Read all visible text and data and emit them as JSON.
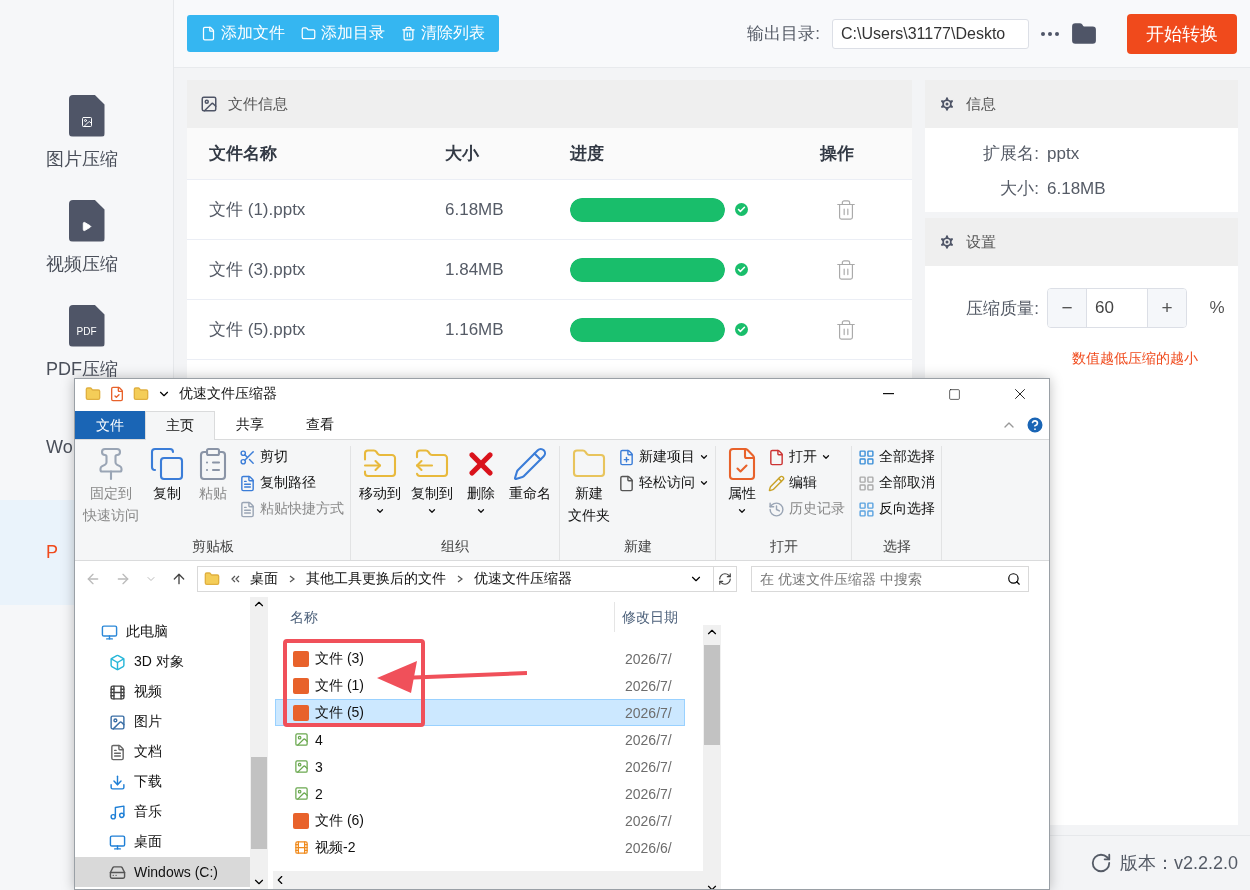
{
  "sidebar": {
    "items": [
      {
        "label": "图片压缩",
        "kind": "image",
        "selected": false
      },
      {
        "label": "视频压缩",
        "kind": "video",
        "selected": false
      },
      {
        "label": "PDF压缩",
        "kind": "pdf",
        "badge": "PDF",
        "selected": false
      },
      {
        "label": "Wo",
        "kind": "word",
        "selected": false
      },
      {
        "label": "P",
        "kind": "ppt",
        "selected": true
      }
    ]
  },
  "toolbar": {
    "buttons": [
      {
        "label": "添加文件",
        "kind": "file"
      },
      {
        "label": "添加目录",
        "kind": "folder"
      },
      {
        "label": "清除列表",
        "kind": "clear"
      }
    ],
    "output_label": "输出目录:",
    "output_path": "C:\\Users\\31177\\Deskto",
    "start_button": "开始转换"
  },
  "file_table": {
    "title": "文件信息",
    "columns": [
      "文件名称",
      "大小",
      "进度",
      "操作"
    ],
    "rows": [
      {
        "name": "文件 (1).pptx",
        "size": "6.18MB",
        "level": 1,
        "done": true
      },
      {
        "name": "文件 (3).pptx",
        "size": "1.84MB",
        "level": 1,
        "done": true
      },
      {
        "name": "文件 (5).pptx",
        "size": "1.16MB",
        "level": 1,
        "done": true
      }
    ]
  },
  "info": {
    "title": "信息",
    "fields": [
      {
        "label": "扩展名:",
        "value": "pptx"
      },
      {
        "label": "大小:",
        "value": "6.18MB"
      }
    ]
  },
  "settings": {
    "title": "设置",
    "quality_label": "压缩质量:",
    "minus": "−",
    "quality_value": "60",
    "plus": "+",
    "unit": "%",
    "hint": "数值越低压缩的越小"
  },
  "status_bar": {
    "version": "版本：v2.2.2.0"
  },
  "explorer": {
    "title": "优速文件压缩器",
    "tabs": [
      {
        "label": "文件",
        "kind": "file",
        "selected": false
      },
      {
        "label": "主页",
        "kind": "tab",
        "selected": true
      },
      {
        "label": "共享",
        "kind": "tab",
        "selected": false
      },
      {
        "label": "查看",
        "kind": "tab",
        "selected": false
      }
    ],
    "groups": [
      {
        "label": "剪贴板",
        "large": [
          {
            "lines": [
              "固定到",
              "快速访问"
            ],
            "kind": "pin",
            "disabled": true,
            "dropdown": false
          },
          {
            "lines": [
              "复制"
            ],
            "kind": "copy",
            "disabled": false,
            "dropdown": false
          },
          {
            "lines": [
              "粘贴"
            ],
            "kind": "paste",
            "disabled": true,
            "dropdown": false
          }
        ],
        "small": [
          {
            "label": "剪切",
            "kind": "cut",
            "disabled": false,
            "dropdown": false
          },
          {
            "label": "复制路径",
            "kind": "path",
            "disabled": false,
            "dropdown": false
          },
          {
            "label": "粘贴快捷方式",
            "kind": "shortcut",
            "disabled": true,
            "dropdown": false
          }
        ]
      },
      {
        "label": "组织",
        "large": [
          {
            "lines": [
              "移动到"
            ],
            "kind": "move",
            "disabled": false,
            "dropdown": true
          },
          {
            "lines": [
              "复制到"
            ],
            "kind": "copyto",
            "disabled": false,
            "dropdown": true
          },
          {
            "lines": [
              "删除"
            ],
            "kind": "delete",
            "disabled": false,
            "dropdown": true
          },
          {
            "lines": [
              "重命名"
            ],
            "kind": "rename",
            "disabled": false,
            "dropdown": false
          }
        ]
      },
      {
        "label": "新建",
        "large": [
          {
            "lines": [
              "新建",
              "文件夹"
            ],
            "kind": "newfolder",
            "disabled": false,
            "dropdown": false
          }
        ],
        "small": [
          {
            "label": "新建项目",
            "kind": "newitem",
            "disabled": false,
            "dropdown": true
          },
          {
            "label": "轻松访问",
            "kind": "easy",
            "disabled": false,
            "dropdown": true
          }
        ]
      },
      {
        "label": "打开",
        "large": [
          {
            "lines": [
              "属性"
            ],
            "kind": "props",
            "disabled": false,
            "dropdown": true
          }
        ],
        "small": [
          {
            "label": "打开",
            "kind": "open",
            "disabled": false,
            "dropdown": true
          },
          {
            "label": "编辑",
            "kind": "edit",
            "disabled": false,
            "dropdown": false
          },
          {
            "label": "历史记录",
            "kind": "history",
            "disabled": true,
            "dropdown": false
          }
        ]
      },
      {
        "label": "选择",
        "small": [
          {
            "label": "全部选择",
            "kind": "selall",
            "disabled": false,
            "dropdown": false
          },
          {
            "label": "全部取消",
            "kind": "selnone",
            "disabled": false,
            "dropdown": false
          },
          {
            "label": "反向选择",
            "kind": "invert",
            "disabled": false,
            "dropdown": false
          }
        ]
      }
    ],
    "breadcrumb": [
      "桌面",
      "其他工具更换后的文件",
      "优速文件压缩器"
    ],
    "search": {
      "placeholder": "在 优速文件压缩器 中搜索"
    },
    "nav": [
      {
        "label": "此电脑",
        "kind": "pc",
        "selected": false
      },
      {
        "label": "3D 对象",
        "kind": "objects",
        "selected": false
      },
      {
        "label": "视频",
        "kind": "video",
        "selected": false
      },
      {
        "label": "图片",
        "kind": "image",
        "selected": false
      },
      {
        "label": "文档",
        "kind": "doc",
        "selected": false
      },
      {
        "label": "下载",
        "kind": "download",
        "selected": false
      },
      {
        "label": "音乐",
        "kind": "music",
        "selected": false
      },
      {
        "label": "桌面",
        "kind": "desktop",
        "selected": false
      },
      {
        "label": "Windows (C:)",
        "kind": "drive",
        "selected": true
      }
    ],
    "columns": [
      "名称",
      "修改日期"
    ],
    "files": [
      {
        "name": "文件 (3)",
        "date": "2026/7/",
        "kind": "ppt",
        "selected": false
      },
      {
        "name": "文件 (1)",
        "date": "2026/7/",
        "kind": "ppt",
        "selected": false
      },
      {
        "name": "文件 (5)",
        "date": "2026/7/",
        "kind": "ppt",
        "selected": true
      },
      {
        "name": "4",
        "date": "2026/7/",
        "kind": "png",
        "selected": false
      },
      {
        "name": "3",
        "date": "2026/7/",
        "kind": "png",
        "selected": false
      },
      {
        "name": "2",
        "date": "2026/7/",
        "kind": "png",
        "selected": false
      },
      {
        "name": "文件 (6)",
        "date": "2026/7/",
        "kind": "ppt",
        "selected": false
      },
      {
        "name": "视频-2",
        "date": "2026/6/",
        "kind": "video",
        "selected": false
      }
    ]
  }
}
